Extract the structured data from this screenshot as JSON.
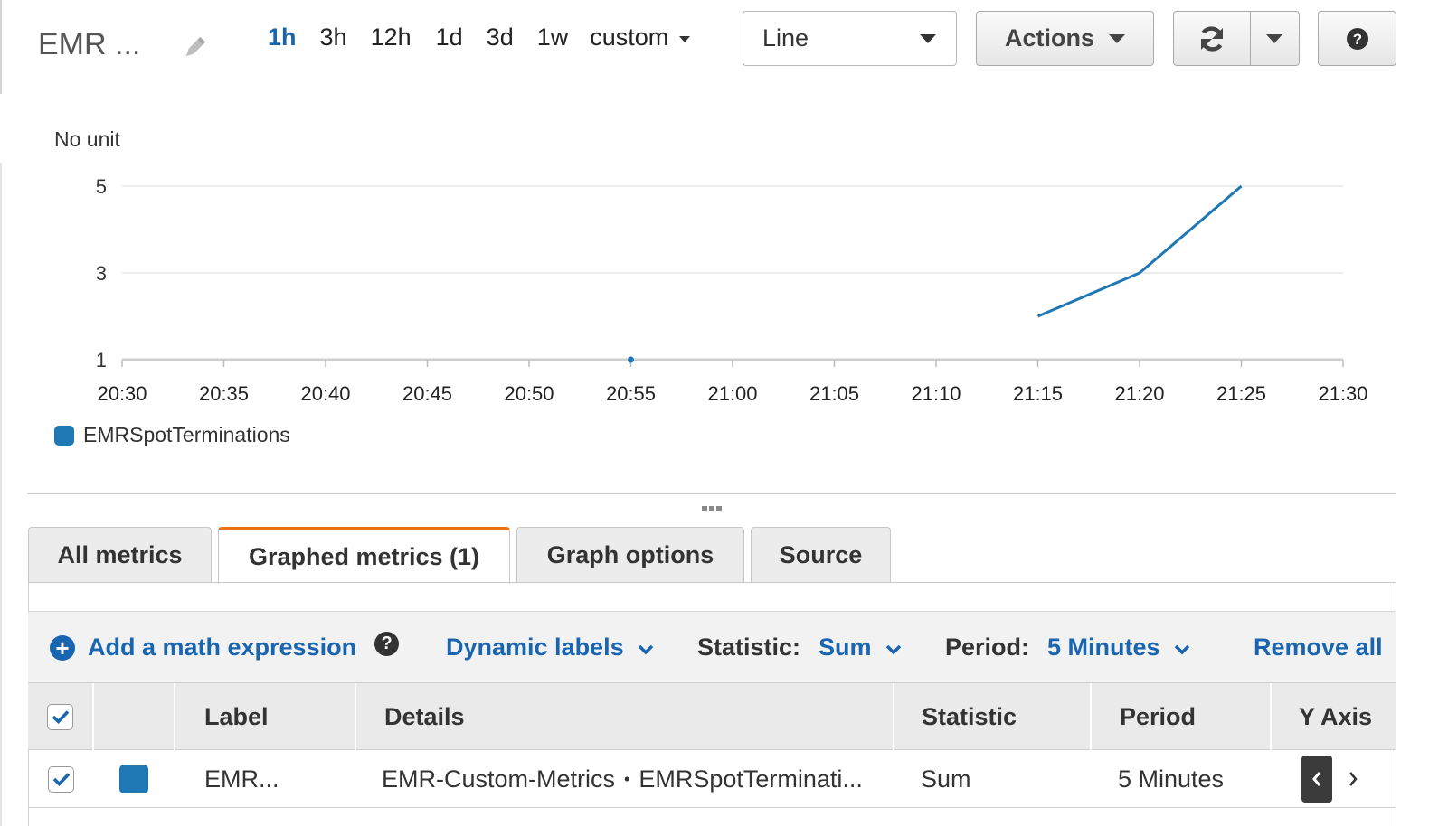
{
  "header": {
    "title": "EMR ...",
    "time_ranges": [
      "1h",
      "3h",
      "12h",
      "1d",
      "3d",
      "1w"
    ],
    "active_range": "1h",
    "custom_label": "custom",
    "graph_type": "Line",
    "actions_label": "Actions"
  },
  "chart": {
    "y_unit": "No unit",
    "legend": "EMRSpotTerminations",
    "accent": "#1f77b4"
  },
  "chart_data": {
    "type": "line",
    "x": [
      "20:55",
      "21:15",
      "21:20",
      "21:25"
    ],
    "series": [
      {
        "name": "EMRSpotTerminations",
        "values": [
          1,
          2,
          3,
          5
        ]
      }
    ],
    "x_ticks": [
      "20:30",
      "20:35",
      "20:40",
      "20:45",
      "20:50",
      "20:55",
      "21:00",
      "21:05",
      "21:10",
      "21:15",
      "21:20",
      "21:25",
      "21:30"
    ],
    "y_ticks": [
      1,
      3,
      5
    ],
    "ylim": [
      1,
      5
    ],
    "ylabel": "No unit",
    "grid": true,
    "legend_position": "bottom-left"
  },
  "tabs": [
    {
      "label": "All metrics"
    },
    {
      "label": "Graphed metrics (1)",
      "active": true
    },
    {
      "label": "Graph options"
    },
    {
      "label": "Source"
    }
  ],
  "toolbar": {
    "add_math": "Add a math expression",
    "dynamic_labels": "Dynamic labels",
    "statistic_label": "Statistic:",
    "statistic_value": "Sum",
    "period_label": "Period:",
    "period_value": "5 Minutes",
    "remove_all": "Remove all"
  },
  "table": {
    "columns": [
      "Label",
      "Details",
      "Statistic",
      "Period",
      "Y Axis"
    ],
    "rows": [
      {
        "checked": true,
        "color": "#1f77b4",
        "label": "EMR...",
        "details_namespace": "EMR-Custom-Metrics",
        "details_metric": "EMRSpotTerminati...",
        "statistic": "Sum",
        "period": "5 Minutes"
      }
    ]
  }
}
